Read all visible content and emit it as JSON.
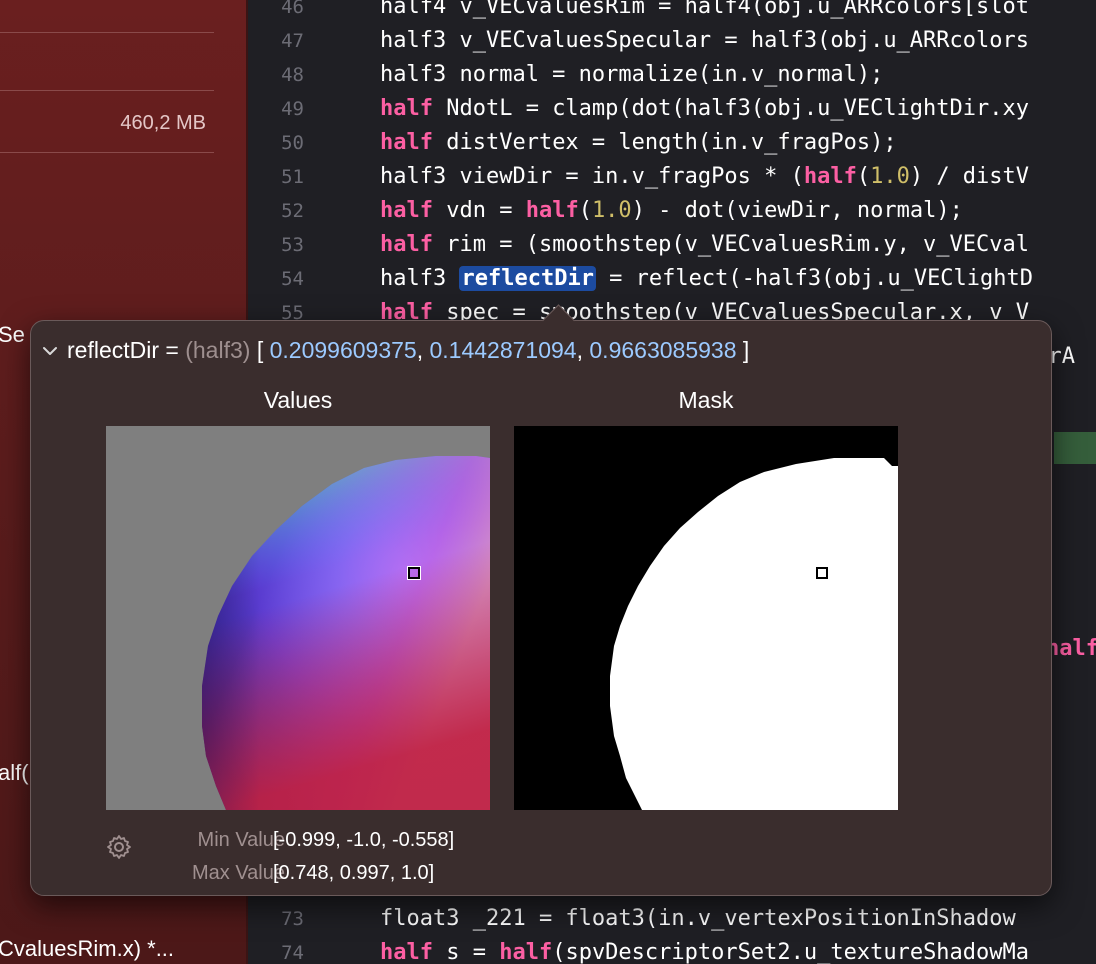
{
  "sidebar": {
    "size_label": "460,2 MB",
    "fragments": [
      "Se",
      "alf(",
      "CvaluesRim.x) *..."
    ]
  },
  "editor": {
    "lines": [
      {
        "n": "46",
        "code": "half4 v_VECvaluesRim = half4(obj.u_ARRcolors[slot"
      },
      {
        "n": "47",
        "code": "half3 v_VECvaluesSpecular = half3(obj.u_ARRcolors"
      },
      {
        "n": "48",
        "code": "half3 normal = normalize(in.v_normal);"
      },
      {
        "n": "49",
        "code": "half NdotL = clamp(dot(half3(obj.u_VEClightDir.xy"
      },
      {
        "n": "50",
        "code": "half distVertex = length(in.v_fragPos);"
      },
      {
        "n": "51",
        "code": "half3 viewDir = in.v_fragPos * (half(1.0) / distV"
      },
      {
        "n": "52",
        "code": "half vdn = half(1.0) - dot(viewDir, normal);"
      },
      {
        "n": "53",
        "code": "half rim = (smoothstep(v_VECvaluesRim.y, v_VECval"
      },
      {
        "n": "54",
        "code": "half3 reflectDir = reflect(-half3(obj.u_VEClightD"
      },
      {
        "n": "55",
        "code": "half spec = smoothstep(v_VECvaluesSpecular.x, v_V"
      },
      {
        "n": "73",
        "code": "float3 _221 = float3(in.v_vertexPositionInShadow"
      },
      {
        "n": "74",
        "code": "half s = half(spvDescriptorSet2.u_textureShadowMa"
      }
    ],
    "right_fragments": {
      "line56": "lorA",
      "pink": "half"
    }
  },
  "popover": {
    "variable": "reflectDir",
    "equals": " = ",
    "type": "(half3)",
    "open_bracket": " [ ",
    "v1": "0.2099609375",
    "sep1": ", ",
    "v2": "0.1442871094",
    "sep2": ", ",
    "v3": "0.9663085938",
    "close_bracket": " ]",
    "values_title": "Values",
    "mask_title": "Mask",
    "min_label": "Min Value",
    "min_value": "[-0.999, -1.0, -0.558]",
    "max_label": "Max Value",
    "max_value": "[0.748, 0.997, 1.0]"
  },
  "colors": {
    "keyword": "#fc5fa3",
    "number": "#d0bf69",
    "selection": "#1c4ba0",
    "value_blue": "#9ccaff"
  },
  "icons": {
    "disclosure": "chevron-down-icon",
    "settings": "gear-icon"
  }
}
